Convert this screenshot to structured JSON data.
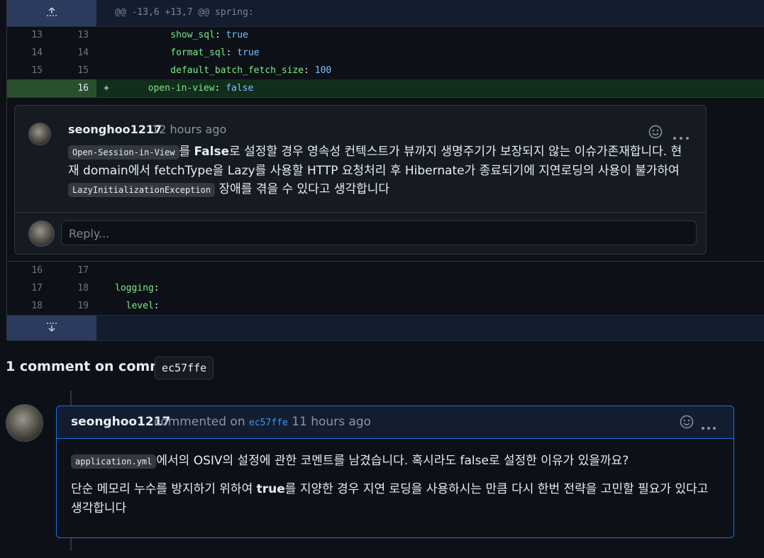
{
  "diff": {
    "hunk_header": "@@ -13,6 +13,7 @@ spring:",
    "expand_up_icon": "expand-up-icon",
    "expand_down_icon": "expand-down-icon",
    "lines_top": [
      {
        "old": "13",
        "new": "13",
        "indent": "          ",
        "key": "show_sql",
        "value": "true"
      },
      {
        "old": "14",
        "new": "14",
        "indent": "          ",
        "key": "format_sql",
        "value": "true"
      },
      {
        "old": "15",
        "new": "15",
        "indent": "          ",
        "key": "default_batch_fetch_size",
        "value": "100"
      }
    ],
    "added_line": {
      "old": "",
      "new": "16",
      "marker": "+",
      "indent": "    ",
      "key": "open-in-view",
      "value": "false"
    },
    "lines_bottom": [
      {
        "old": "16",
        "new": "17",
        "indent": "",
        "key": "",
        "value": ""
      },
      {
        "old": "17",
        "new": "18",
        "indent": "",
        "key": "logging",
        "value": ""
      },
      {
        "old": "18",
        "new": "19",
        "indent": "  ",
        "key": "level",
        "value": ""
      }
    ]
  },
  "review_comment": {
    "author": "seonghoo1217",
    "time": "12 hours ago",
    "code1": "Open-Session-in-View",
    "text1": "를 ",
    "bold1": "False",
    "text2": "로 설정할 경우 영속성 컨텍스트가 뷰까지 생명주기가 보장되지 않는 이슈가존재합니다. 현재 domain에서 fetchType을 Lazy를 사용할 HTTP 요청처리 후 Hibernate가 종료되기에 지연로딩의 사용이 불가하여 ",
    "code2": "LazyInitializationException",
    "text3": " 장애를 겪을 수 있다고 생각합니다",
    "reply_placeholder": "Reply..."
  },
  "commit_section": {
    "heading": "1 comment on commit",
    "sha": "ec57ffe"
  },
  "commit_comment": {
    "author": "seonghoo1217",
    "action": "commented on",
    "sha": "ec57ffe",
    "time": "11 hours ago",
    "p1_code": "application.yml",
    "p1_text": "에서의 OSIV의 설정에 관한 코멘트를 남겼습니다. 혹시라도 false로 설정한 이유가 있을까요?",
    "p2_text1": "단순 메모리 누수를 방지하기 위하여 ",
    "p2_bold": "true",
    "p2_text2": "를 지양한 경우 지연 로딩을 사용하시는 만큼 다시 한번 전략을 고민할 필요가 있다고 생각합니다"
  },
  "icons": {
    "reaction": "smiley-icon",
    "more": "kebab-horizontal-icon"
  }
}
